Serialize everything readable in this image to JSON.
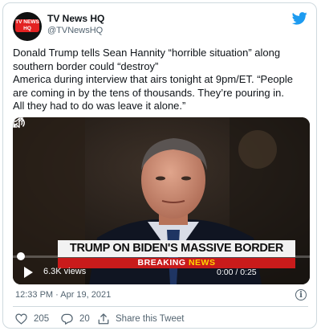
{
  "account": {
    "name": "TV News HQ",
    "handle": "@TVNewsHQ",
    "logo_text": "TV NEWS HQ"
  },
  "tweet": {
    "lines": [
      "Donald Trump tells Sean Hannity “horrible situation” along",
      "southern border could “destroy”",
      "America during interview that airs tonight at 9pm/ET. “People",
      "are coming in by the tens of thousands. They’re pouring in.",
      "All they had to do was leave it alone.”"
    ]
  },
  "video": {
    "chyron": "TRUMP ON BIDEN'S MASSIVE BORDER FAILURES",
    "breaking_label": "BREAKING",
    "news_label": "NEWS",
    "views": "6.3K views",
    "time": "0:00 / 0:25",
    "progress": 0
  },
  "meta": {
    "timestamp": "12:33 PM · Apr 19, 2021"
  },
  "actions": {
    "likes": "205",
    "replies": "20",
    "share_label": "Share this Tweet"
  },
  "colors": {
    "brand_blue": "#1d9bf0",
    "text_secondary": "#536471",
    "border": "#cfd9de",
    "breaking_red": "#c91b1b",
    "logo_red": "#e32222"
  },
  "icons": [
    "twitter-bird-icon",
    "play-icon",
    "volume-icon",
    "expand-icon",
    "info-icon",
    "heart-icon",
    "reply-icon",
    "share-icon"
  ]
}
